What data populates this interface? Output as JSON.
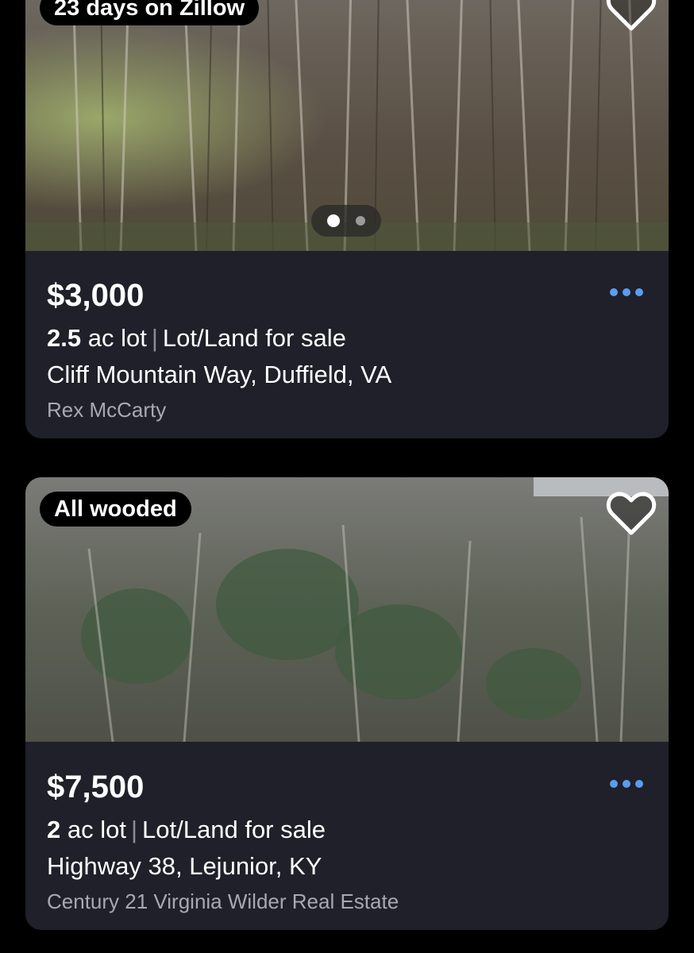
{
  "listings": [
    {
      "tag": "23 days on Zillow",
      "price": "$3,000",
      "acreage": "2.5",
      "acreage_unit": "ac lot",
      "separator": "|",
      "type": "Lot/Land for sale",
      "address": "Cliff Mountain Way, Duffield, VA",
      "agent": "Rex McCarty",
      "photo_count": 2,
      "current_photo": 1,
      "favorite_icon": "heart-outline-icon",
      "more_icon": "more-dots-icon"
    },
    {
      "tag": "All wooded",
      "price": "$7,500",
      "acreage": "2",
      "acreage_unit": "ac lot",
      "separator": "|",
      "type": "Lot/Land for sale",
      "address": "Highway 38, Lejunior, KY",
      "agent": "Century 21 Virginia Wilder Real Estate",
      "favorite_icon": "heart-outline-icon",
      "more_icon": "more-dots-icon"
    }
  ],
  "colors": {
    "background": "#000000",
    "card": "#1f2029",
    "accent": "#5b9cf0",
    "secondary_text": "#a8a8b2"
  }
}
